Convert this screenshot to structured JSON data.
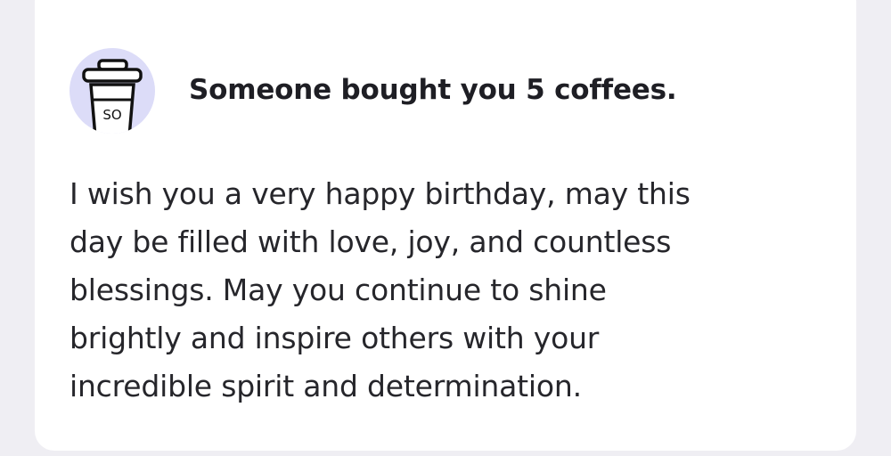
{
  "notification": {
    "avatar_icon": "coffee-cup-icon",
    "avatar_badge_text": "SO",
    "title": "Someone bought you 5 coffees.",
    "message": "I wish you a very happy birthday, may this\nday be filled with love, joy, and countless\nblessings. May you continue to shine\nbrightly and inspire others with your\nincredible spirit and determination."
  },
  "colors": {
    "background": "#efeef3",
    "card": "#ffffff",
    "avatar_bg": "#dcdcf8",
    "text": "#26262b"
  }
}
